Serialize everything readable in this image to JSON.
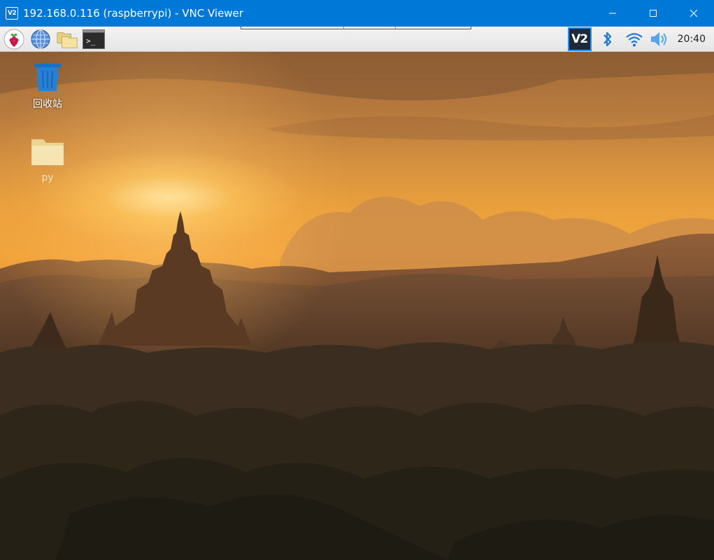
{
  "window": {
    "title": "192.168.0.116 (raspberrypi) - VNC Viewer",
    "app_icon_text": "V2",
    "controls": {
      "minimize": "minimize-icon",
      "maximize": "maximize-icon",
      "close": "close-icon"
    }
  },
  "taskbar": {
    "launchers": [
      {
        "name": "raspberry-menu",
        "icon": "raspberry-icon"
      },
      {
        "name": "web-browser",
        "icon": "globe-icon"
      },
      {
        "name": "file-manager",
        "icon": "folders-icon"
      },
      {
        "name": "terminal",
        "icon": "terminal-icon",
        "prompt": ">_"
      }
    ],
    "tray": {
      "vnc_icon_text": "V2",
      "icons": [
        "vnc-server-icon",
        "bluetooth-icon",
        "wifi-icon",
        "volume-icon"
      ],
      "clock": "20:40"
    }
  },
  "desktop": {
    "icons": [
      {
        "label": "回收站",
        "icon": "trash-icon"
      },
      {
        "label": "py",
        "icon": "folder-icon"
      }
    ]
  },
  "colors": {
    "titlebar": "#0078d7",
    "taskbar": "#eeeeee",
    "vnc_accent": "#1e90ff"
  }
}
